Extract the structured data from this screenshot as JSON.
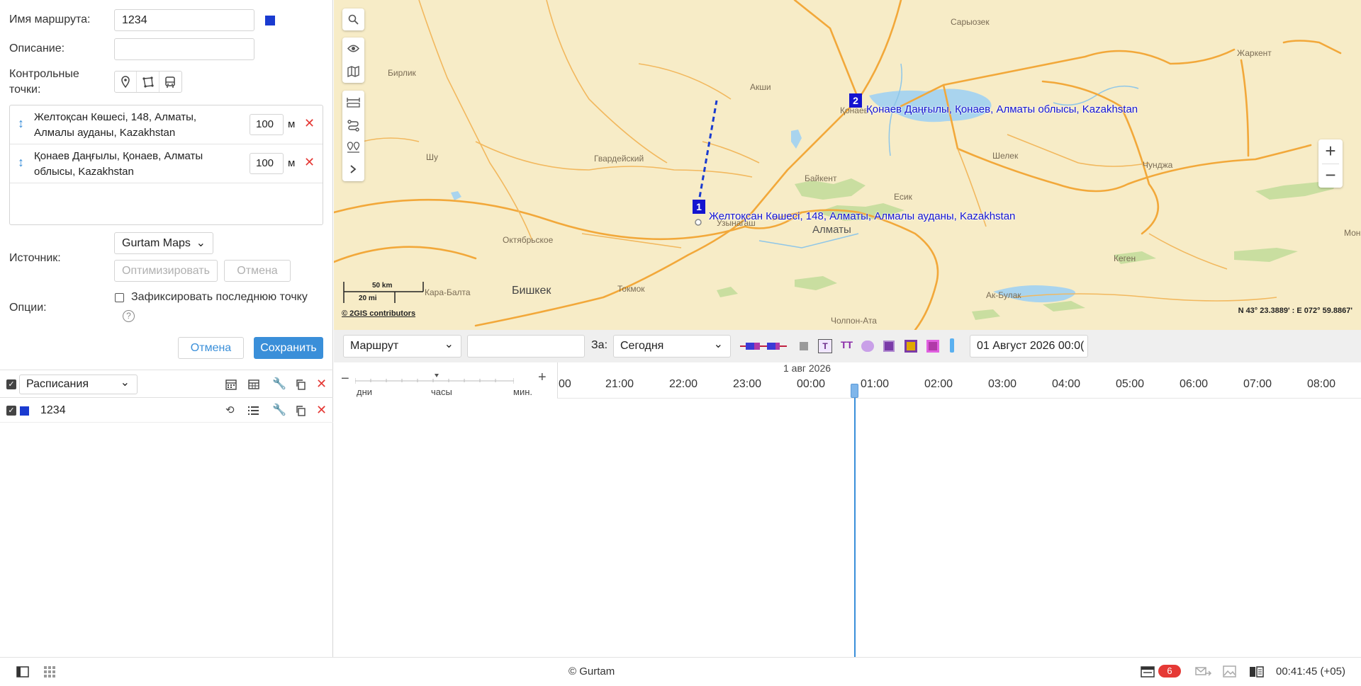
{
  "route_form": {
    "name_label": "Имя маршрута:",
    "name_value": "1234",
    "route_color": "#1a3bd0",
    "description_label": "Описание:",
    "description_value": "",
    "checkpoints_label_1": "Контрольные",
    "checkpoints_label_2": "точки:",
    "checkpoints": [
      {
        "address_line1": "Желтоқсан Көшесі, 148, Алматы,",
        "address_line2": "Алмалы ауданы, Kazakhstan",
        "radius": "100",
        "unit": "м"
      },
      {
        "address_line1": "Қонаев Даңғылы, Қонаев, Алматы",
        "address_line2": "облысы, Kazakhstan",
        "radius": "100",
        "unit": "м"
      }
    ],
    "source_label": "Источник:",
    "source_value": "Gurtam Maps",
    "optimize_button": "Оптимизировать",
    "cancel_small_button": "Отмена",
    "options_label": "Опции:",
    "fix_last_point_label": "Зафиксировать последнюю точку",
    "cancel_button": "Отмена",
    "save_button": "Сохранить"
  },
  "schedules_panel": {
    "dropdown_value": "Расписания",
    "rows": [
      {
        "name": "1234",
        "color": "#1a3bd0"
      }
    ]
  },
  "map": {
    "places": [
      "Сарыозек",
      "Жаркент",
      "Бирлик",
      "Акши",
      "Қонаев",
      "Шу",
      "Гвардейский",
      "Байкент",
      "Шелек",
      "Чунджа",
      "Есик",
      "Узынагаш",
      "Алматы",
      "Октябрьское",
      "Кеген",
      "Кара-Балта",
      "Бишкек",
      "Токмок",
      "Ак-Булак",
      "Чолпон-Ата",
      "Мон"
    ],
    "marker_1": "1",
    "marker_1_label": "Желтоқсан Көшесі, 148, Алматы, Алмалы ауданы, Kazakhstan",
    "marker_2": "2",
    "marker_2_label": "Қонаев Даңғылы, Қонаев, Алматы облысы, Kazakhstan",
    "scale_km": "50 km",
    "scale_mi": "20 mi",
    "attribution": "© 2GIS contributors",
    "coords": "N 43° 23.3889' : E 072° 59.8867'",
    "zoom_in": "+",
    "zoom_out": "−"
  },
  "timeline": {
    "type_value": "Маршрут",
    "search_value": "",
    "period_label": "За:",
    "period_value": "Сегодня",
    "date_value": "01 Август 2026 00:0(",
    "date_header": "1 авг 2026",
    "scale_labels": [
      "дни",
      "часы",
      "мин."
    ],
    "hours": [
      "00",
      "21:00",
      "22:00",
      "23:00",
      "00:00",
      "01:00",
      "02:00",
      "03:00",
      "04:00",
      "05:00",
      "06:00",
      "07:00",
      "08:00"
    ]
  },
  "status_bar": {
    "copyright": "© Gurtam",
    "notifications_count": "6",
    "time": "00:41:45 (+05)"
  }
}
